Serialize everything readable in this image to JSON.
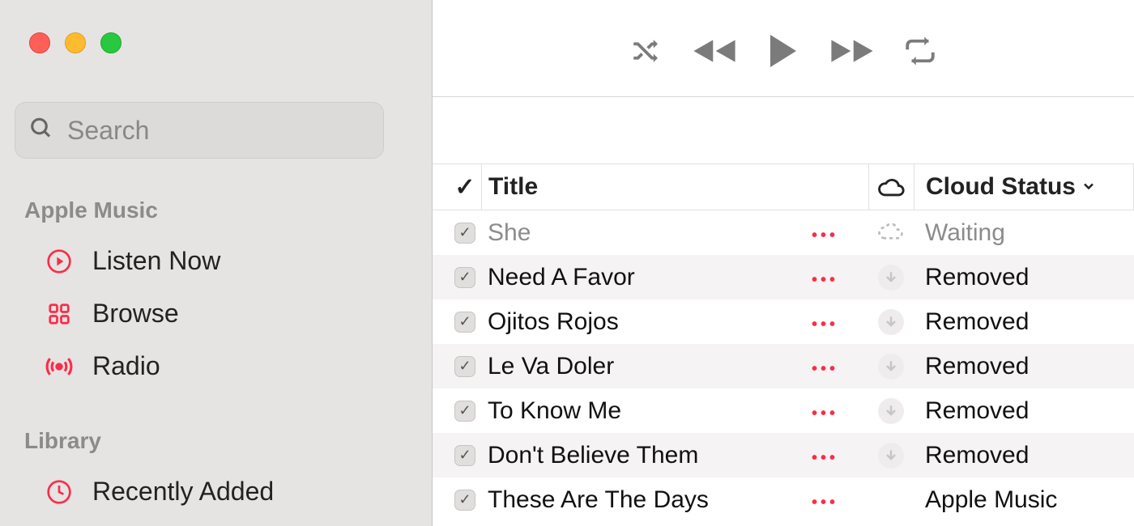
{
  "sidebar": {
    "search_placeholder": "Search",
    "sections": [
      {
        "label": "Apple Music",
        "items": [
          {
            "icon": "play-circle",
            "label": "Listen Now"
          },
          {
            "icon": "grid",
            "label": "Browse"
          },
          {
            "icon": "radio",
            "label": "Radio"
          }
        ]
      },
      {
        "label": "Library",
        "items": [
          {
            "icon": "clock",
            "label": "Recently Added"
          }
        ]
      }
    ]
  },
  "table": {
    "headers": {
      "check": "✓",
      "title": "Title",
      "cloud_status": "Cloud Status"
    },
    "rows": [
      {
        "checked": true,
        "dim": true,
        "title": "She",
        "cloud_icon": "dashed",
        "status": "Waiting"
      },
      {
        "checked": true,
        "dim": false,
        "title": "Need A Favor",
        "cloud_icon": "download",
        "status": "Removed"
      },
      {
        "checked": true,
        "dim": false,
        "title": "Ojitos Rojos",
        "cloud_icon": "download",
        "status": "Removed"
      },
      {
        "checked": true,
        "dim": false,
        "title": "Le Va Doler",
        "cloud_icon": "download",
        "status": "Removed"
      },
      {
        "checked": true,
        "dim": false,
        "title": "To Know Me",
        "cloud_icon": "download",
        "status": "Removed"
      },
      {
        "checked": true,
        "dim": false,
        "title": "Don't Believe Them",
        "cloud_icon": "download",
        "status": "Removed"
      },
      {
        "checked": true,
        "dim": false,
        "title": "These Are The Days",
        "cloud_icon": "none",
        "status": "Apple Music"
      }
    ]
  },
  "highlight_column": "cloud_status"
}
